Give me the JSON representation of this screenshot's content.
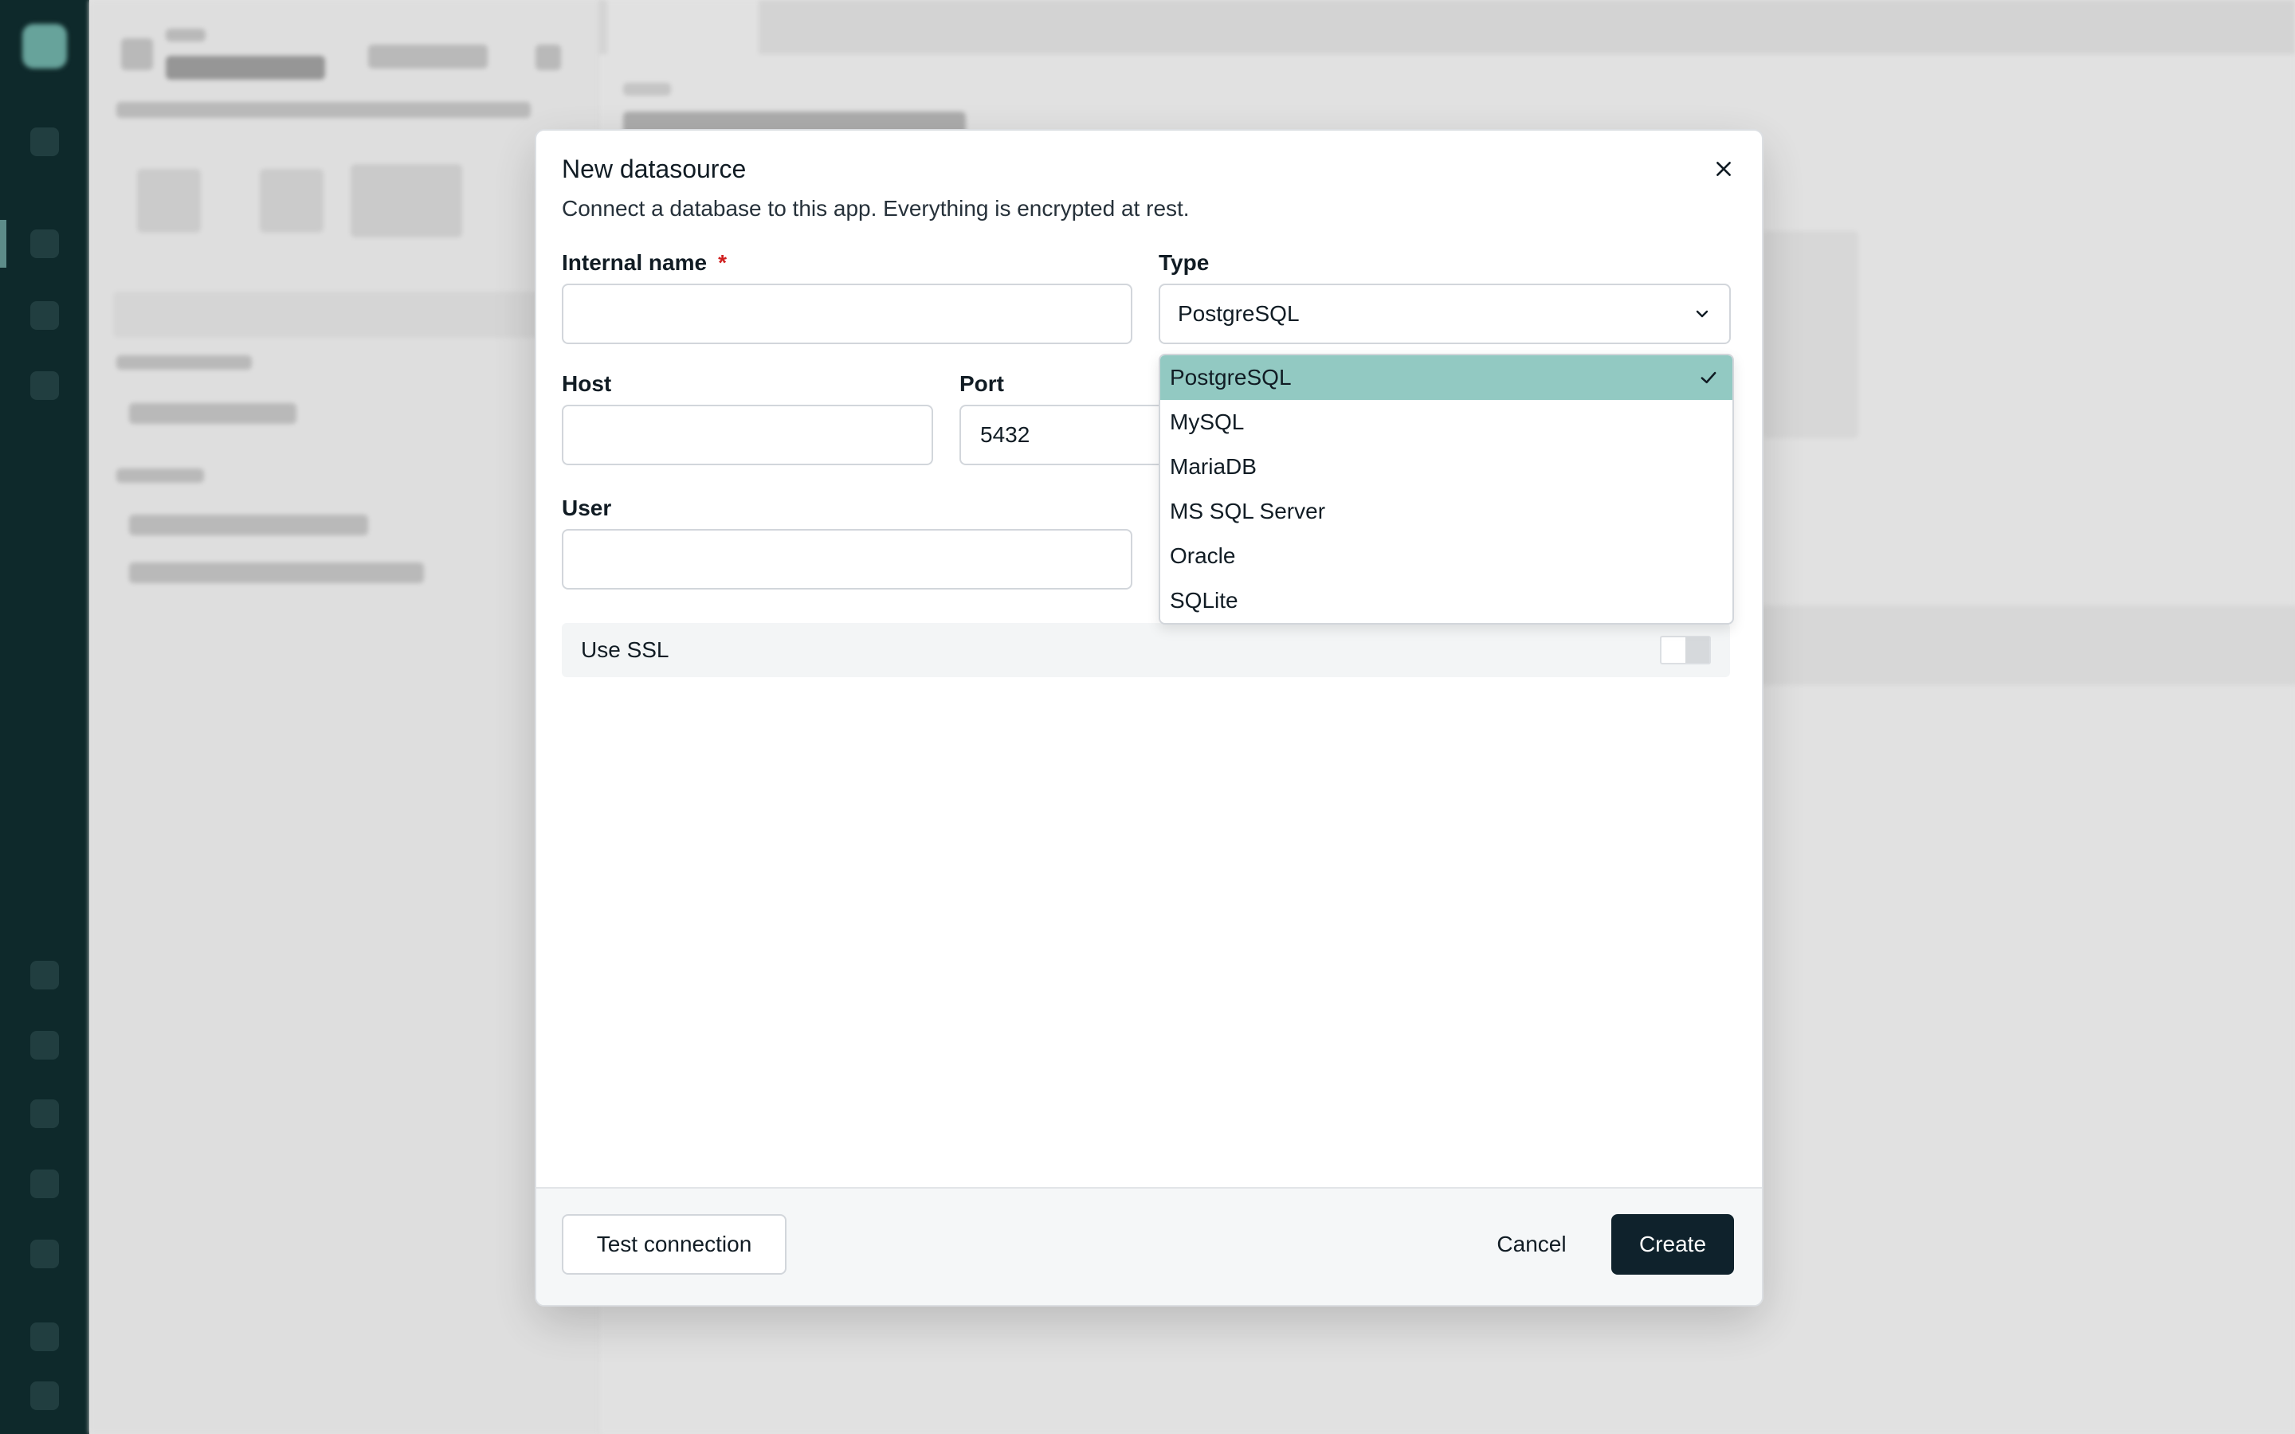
{
  "dialog": {
    "title": "New datasource",
    "description": "Connect a database to this app. Everything is encrypted at rest."
  },
  "form": {
    "internal_name": {
      "label": "Internal name",
      "required_mark": "*",
      "value": ""
    },
    "type": {
      "label": "Type",
      "value": "PostgreSQL"
    },
    "host": {
      "label": "Host",
      "value": ""
    },
    "port": {
      "label": "Port",
      "value": "5432"
    },
    "user": {
      "label": "User",
      "value": ""
    },
    "ssl": {
      "label": "Use SSL",
      "enabled": false
    }
  },
  "type_options": [
    {
      "label": "PostgreSQL",
      "selected": true
    },
    {
      "label": "MySQL",
      "selected": false
    },
    {
      "label": "MariaDB",
      "selected": false
    },
    {
      "label": "MS SQL Server",
      "selected": false
    },
    {
      "label": "Oracle",
      "selected": false
    },
    {
      "label": "SQLite",
      "selected": false
    }
  ],
  "footer": {
    "test_label": "Test connection",
    "cancel_label": "Cancel",
    "create_label": "Create"
  },
  "colors": {
    "primary": "#0f222c",
    "selected_option": "#92c9c2",
    "required": "#d01f1f",
    "rail": "#0f2a2c"
  }
}
